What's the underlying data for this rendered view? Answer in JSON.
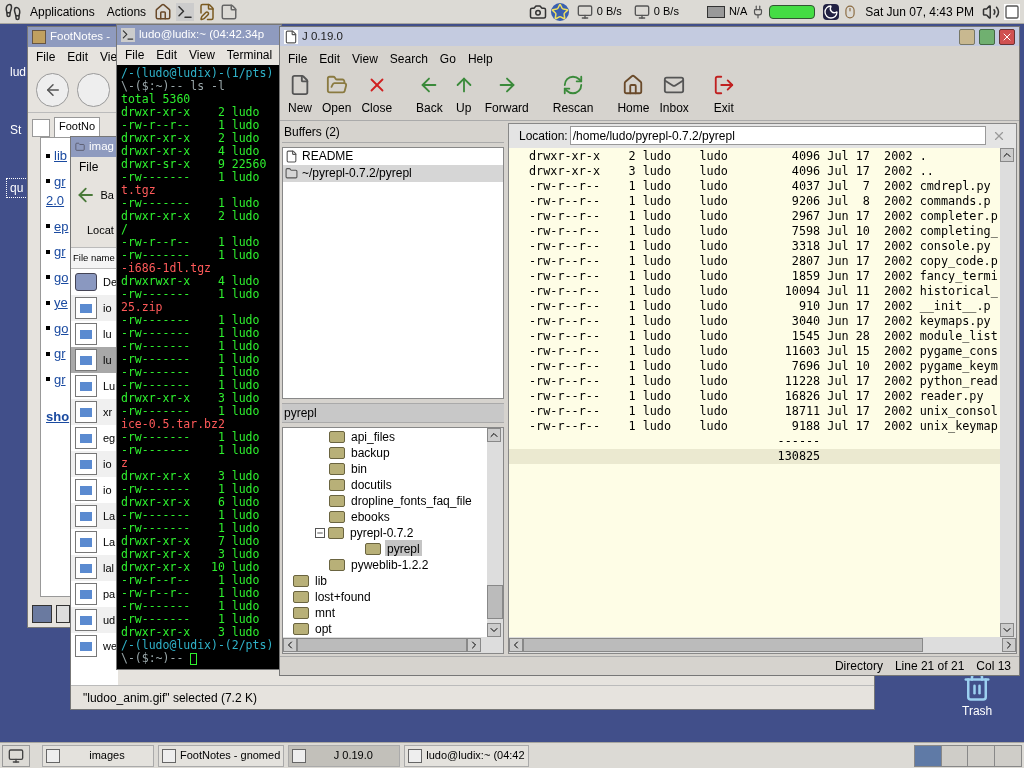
{
  "top_panel": {
    "menus": [
      "Applications",
      "Actions"
    ],
    "net_down": "0 B/s",
    "net_up": "0 B/s",
    "power": "N/A",
    "clock": "Sat Jun 07, 4:43 PM"
  },
  "desktop_icons": [
    {
      "label": "lud",
      "selected": false
    },
    {
      "label": "St",
      "selected": false
    },
    {
      "label": "qu",
      "selected": true
    }
  ],
  "trash": {
    "label": "Trash"
  },
  "footnotes_window": {
    "title": "FootNotes -",
    "menu": [
      "File",
      "Edit",
      "Vie"
    ],
    "tab": "FootNo",
    "links": [
      {
        "text": "lib"
      },
      {
        "text": "gr",
        "wrap": "2.0"
      },
      {
        "text": "ep"
      },
      {
        "text": "gr"
      },
      {
        "text": "go"
      },
      {
        "text": "ye"
      },
      {
        "text": "go"
      },
      {
        "text": "gr"
      },
      {
        "text": "gr"
      }
    ],
    "more_link": "sho"
  },
  "images_window": {
    "title": "imag",
    "menu": [
      "File"
    ],
    "back": "Ba",
    "location": "Locat",
    "column": "File name",
    "files": [
      {
        "name": "De",
        "kind": "folder",
        "selected": false
      },
      {
        "name": "io",
        "kind": "image",
        "selected": false
      },
      {
        "name": "lu",
        "kind": "image",
        "selected": false
      },
      {
        "name": "lu",
        "kind": "image",
        "selected": true
      },
      {
        "name": "Lu",
        "kind": "image",
        "selected": false
      },
      {
        "name": "xr",
        "kind": "image",
        "selected": false
      },
      {
        "name": "eg",
        "kind": "image",
        "selected": false
      },
      {
        "name": "io",
        "kind": "image",
        "selected": false
      },
      {
        "name": "io",
        "kind": "image",
        "selected": false
      },
      {
        "name": "La",
        "kind": "image",
        "selected": false
      },
      {
        "name": "La",
        "kind": "image",
        "selected": false
      },
      {
        "name": "lal",
        "kind": "image",
        "selected": false
      },
      {
        "name": "pa",
        "kind": "image",
        "selected": false
      },
      {
        "name": "ud",
        "kind": "image",
        "selected": false
      },
      {
        "name": "we",
        "kind": "image",
        "selected": false
      }
    ],
    "status": "\"ludoo_anim.gif\" selected (7.2 K)"
  },
  "terminal": {
    "title": "ludo@ludix:~ (04:42.34p",
    "menu": [
      "File",
      "Edit",
      "View",
      "Terminal"
    ],
    "lines": [
      {
        "kind": "prompt",
        "text": "/-(ludo@ludix)-(1/pts)"
      },
      {
        "kind": "command",
        "text": "\\-($:~)-- ls -l"
      },
      {
        "kind": "listing",
        "text": "total 5360"
      },
      {
        "kind": "listing",
        "text": "drwxr-xr-x    2 ludo"
      },
      {
        "kind": "listing",
        "text": "-rw-r--r--    1 ludo"
      },
      {
        "kind": "listing",
        "text": "drwxr-xr-x    2 ludo"
      },
      {
        "kind": "listing",
        "text": "drwxr-xr-x    4 ludo"
      },
      {
        "kind": "listing",
        "text": "drwxr-sr-x    9 22560"
      },
      {
        "kind": "listing",
        "text": "-rw-------    1 ludo"
      },
      {
        "kind": "archive",
        "text": "t.tgz"
      },
      {
        "kind": "listing",
        "text": "-rw-------    1 ludo"
      },
      {
        "kind": "listing",
        "text": "drwxr-xr-x    2 ludo"
      },
      {
        "kind": "listing",
        "text": "/"
      },
      {
        "kind": "listing",
        "text": "-rw-r--r--    1 ludo"
      },
      {
        "kind": "listing",
        "text": "-rw-------    1 ludo"
      },
      {
        "kind": "archive",
        "text": "-i686-1dl.tgz"
      },
      {
        "kind": "listing",
        "text": "drwxrwxr-x    4 ludo"
      },
      {
        "kind": "listing",
        "text": "-rw-------    1 ludo"
      },
      {
        "kind": "archive",
        "text": "25.zip"
      },
      {
        "kind": "listing",
        "text": "-rw-------    1 ludo"
      },
      {
        "kind": "listing",
        "text": "-rw-------    1 ludo"
      },
      {
        "kind": "listing",
        "text": "-rw-------    1 ludo"
      },
      {
        "kind": "listing",
        "text": "-rw-------    1 ludo"
      },
      {
        "kind": "listing",
        "text": "-rw-------    1 ludo"
      },
      {
        "kind": "listing",
        "text": "-rw-------    1 ludo"
      },
      {
        "kind": "listing",
        "text": "drwxr-xr-x    3 ludo"
      },
      {
        "kind": "listing",
        "text": "-rw-------    1 ludo"
      },
      {
        "kind": "archive",
        "text": "ice-0.5.tar.bz2"
      },
      {
        "kind": "listing",
        "text": "-rw-------    1 ludo"
      },
      {
        "kind": "listing",
        "text": "-rw-------    1 ludo"
      },
      {
        "kind": "archive",
        "text": "z"
      },
      {
        "kind": "listing",
        "text": "drwxr-xr-x    3 ludo"
      },
      {
        "kind": "listing",
        "text": "-rw-------    1 ludo"
      },
      {
        "kind": "listing",
        "text": "drwxr-xr-x    6 ludo"
      },
      {
        "kind": "listing",
        "text": "-rw-------    1 ludo"
      },
      {
        "kind": "listing",
        "text": "-rw-------    1 ludo"
      },
      {
        "kind": "listing",
        "text": "drwxr-xr-x    7 ludo"
      },
      {
        "kind": "listing",
        "text": "drwxr-xr-x    3 ludo"
      },
      {
        "kind": "listing",
        "text": "drwxr-xr-x   10 ludo"
      },
      {
        "kind": "listing",
        "text": "-rw-r--r--    1 ludo"
      },
      {
        "kind": "listing",
        "text": "-rw-r--r--    1 ludo"
      },
      {
        "kind": "listing",
        "text": "-rw-------    1 ludo"
      },
      {
        "kind": "listing",
        "text": "-rw-------    1 ludo"
      },
      {
        "kind": "listing",
        "text": "drwxr-xr-x    3 ludo"
      },
      {
        "kind": "prompt",
        "text": "/-(ludo@ludix)-(2/pts)"
      },
      {
        "kind": "command",
        "text": "\\-($:~)--"
      }
    ]
  },
  "j_window": {
    "title": "J 0.19.0",
    "menu": [
      "File",
      "Edit",
      "View",
      "Search",
      "Go",
      "Help"
    ],
    "toolbar": [
      "New",
      "Open",
      "Close",
      "Back",
      "Up",
      "Forward",
      "Rescan",
      "Home",
      "Inbox",
      "Exit"
    ],
    "buffers_header": "Buffers (2)",
    "buffers": [
      {
        "label": "README",
        "kind": "file",
        "selected": false
      },
      {
        "label": "~/pyrepl-0.7.2/pyrepl",
        "kind": "folder",
        "selected": true
      }
    ],
    "tree_header": "pyrepl",
    "tree": [
      {
        "children": [
          {
            "label": "api_files",
            "selected": false
          },
          {
            "label": "backup",
            "selected": false
          },
          {
            "label": "bin",
            "selected": false
          },
          {
            "label": "docutils",
            "selected": false
          },
          {
            "label": "dropline_fonts_faq_file",
            "selected": false
          },
          {
            "label": "ebooks",
            "selected": false
          },
          {
            "label": "pyrepl-0.7.2",
            "selected": false,
            "expanded": true,
            "children": [
              {
                "label": "pyrepl",
                "selected": true
              }
            ]
          },
          {
            "label": "pyweblib-1.2.2",
            "selected": false
          }
        ]
      },
      {
        "label": "lib",
        "selected": false
      },
      {
        "label": "lost+found",
        "selected": false
      },
      {
        "label": "mnt",
        "selected": false
      },
      {
        "label": "opt",
        "selected": false
      }
    ],
    "location_label": "Location:",
    "location": "/home/ludo/pyrepl-0.7.2/pyrepl",
    "listing": [
      {
        "perms": "drwxr-xr-x",
        "links": "2",
        "owner": "ludo",
        "group": "ludo",
        "size": "4096",
        "month": "Jul",
        "day": "17",
        "year": "2002",
        "name": "."
      },
      {
        "perms": "drwxr-xr-x",
        "links": "3",
        "owner": "ludo",
        "group": "ludo",
        "size": "4096",
        "month": "Jul",
        "day": "17",
        "year": "2002",
        "name": ".."
      },
      {
        "perms": "-rw-r--r--",
        "links": "1",
        "owner": "ludo",
        "group": "ludo",
        "size": "4037",
        "month": "Jul",
        "day": "7",
        "year": "2002",
        "name": "cmdrepl.py"
      },
      {
        "perms": "-rw-r--r--",
        "links": "1",
        "owner": "ludo",
        "group": "ludo",
        "size": "9206",
        "month": "Jul",
        "day": "8",
        "year": "2002",
        "name": "commands.p"
      },
      {
        "perms": "-rw-r--r--",
        "links": "1",
        "owner": "ludo",
        "group": "ludo",
        "size": "2967",
        "month": "Jun",
        "day": "17",
        "year": "2002",
        "name": "completer.p"
      },
      {
        "perms": "-rw-r--r--",
        "links": "1",
        "owner": "ludo",
        "group": "ludo",
        "size": "7598",
        "month": "Jul",
        "day": "10",
        "year": "2002",
        "name": "completing_"
      },
      {
        "perms": "-rw-r--r--",
        "links": "1",
        "owner": "ludo",
        "group": "ludo",
        "size": "3318",
        "month": "Jul",
        "day": "17",
        "year": "2002",
        "name": "console.py"
      },
      {
        "perms": "-rw-r--r--",
        "links": "1",
        "owner": "ludo",
        "group": "ludo",
        "size": "2807",
        "month": "Jun",
        "day": "17",
        "year": "2002",
        "name": "copy_code.p"
      },
      {
        "perms": "-rw-r--r--",
        "links": "1",
        "owner": "ludo",
        "group": "ludo",
        "size": "1859",
        "month": "Jun",
        "day": "17",
        "year": "2002",
        "name": "fancy_termi"
      },
      {
        "perms": "-rw-r--r--",
        "links": "1",
        "owner": "ludo",
        "group": "ludo",
        "size": "10094",
        "month": "Jul",
        "day": "11",
        "year": "2002",
        "name": "historical_"
      },
      {
        "perms": "-rw-r--r--",
        "links": "1",
        "owner": "ludo",
        "group": "ludo",
        "size": "910",
        "month": "Jun",
        "day": "17",
        "year": "2002",
        "name": "__init__.p"
      },
      {
        "perms": "-rw-r--r--",
        "links": "1",
        "owner": "ludo",
        "group": "ludo",
        "size": "3040",
        "month": "Jun",
        "day": "17",
        "year": "2002",
        "name": "keymaps.py"
      },
      {
        "perms": "-rw-r--r--",
        "links": "1",
        "owner": "ludo",
        "group": "ludo",
        "size": "1545",
        "month": "Jun",
        "day": "28",
        "year": "2002",
        "name": "module_list"
      },
      {
        "perms": "-rw-r--r--",
        "links": "1",
        "owner": "ludo",
        "group": "ludo",
        "size": "11603",
        "month": "Jul",
        "day": "15",
        "year": "2002",
        "name": "pygame_cons"
      },
      {
        "perms": "-rw-r--r--",
        "links": "1",
        "owner": "ludo",
        "group": "ludo",
        "size": "7696",
        "month": "Jul",
        "day": "10",
        "year": "2002",
        "name": "pygame_keym"
      },
      {
        "perms": "-rw-r--r--",
        "links": "1",
        "owner": "ludo",
        "group": "ludo",
        "size": "11228",
        "month": "Jul",
        "day": "17",
        "year": "2002",
        "name": "python_read"
      },
      {
        "perms": "-rw-r--r--",
        "links": "1",
        "owner": "ludo",
        "group": "ludo",
        "size": "16826",
        "month": "Jul",
        "day": "17",
        "year": "2002",
        "name": "reader.py"
      },
      {
        "perms": "-rw-r--r--",
        "links": "1",
        "owner": "ludo",
        "group": "ludo",
        "size": "18711",
        "month": "Jul",
        "day": "17",
        "year": "2002",
        "name": "unix_consol"
      },
      {
        "perms": "-rw-r--r--",
        "links": "1",
        "owner": "ludo",
        "group": "ludo",
        "size": "9188",
        "month": "Jul",
        "day": "17",
        "year": "2002",
        "name": "unix_keymap"
      }
    ],
    "separator": "------",
    "total": "130825",
    "status": [
      "Directory",
      "Line 21 of 21",
      "Col 13"
    ]
  },
  "taskbar": {
    "tasks": [
      {
        "label": "images",
        "selected": false
      },
      {
        "label": "FootNotes - gnomed",
        "selected": false
      },
      {
        "label": "J 0.19.0",
        "selected": true
      },
      {
        "label": "ludo@ludix:~ (04:42",
        "selected": false
      }
    ]
  }
}
